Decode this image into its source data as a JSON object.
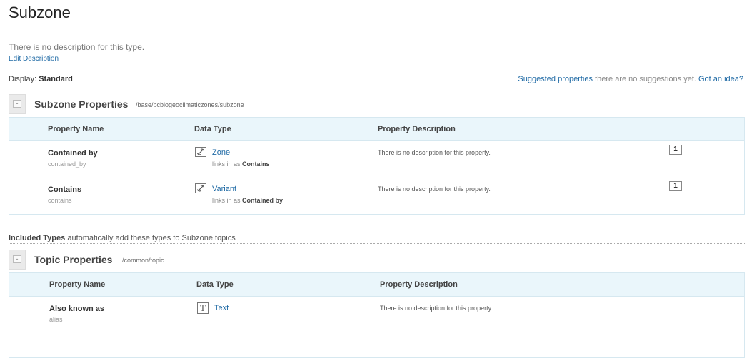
{
  "page": {
    "title": "Subzone",
    "description": "There is no description for this type.",
    "edit_label": "Edit Description",
    "display_label": "Display:",
    "display_value": "Standard",
    "suggest_link": "Suggested properties",
    "suggest_text": "there are no suggestions yet.",
    "suggest_idea": "Got an idea?"
  },
  "sections": [
    {
      "title": "Subzone Properties",
      "path": "/base/bcbiogeoclimaticzones/subzone",
      "headers": [
        "Property Name",
        "Data Type",
        "Property Description"
      ],
      "rows": [
        {
          "name": "Contained by",
          "key": "contained_by",
          "type_icon": "link-icon",
          "type": "Zone",
          "links_prefix": "links in as",
          "links_as": "Contains",
          "description": "There is no description for this property.",
          "count": "1"
        },
        {
          "name": "Contains",
          "key": "contains",
          "type_icon": "link-icon",
          "type": "Variant",
          "links_prefix": "links in as",
          "links_as": "Contained by",
          "description": "There is no description for this property.",
          "count": "1"
        }
      ]
    },
    {
      "title": "Topic Properties",
      "path": "/common/topic",
      "headers": [
        "Property Name",
        "Data Type",
        "Property Description"
      ],
      "rows": [
        {
          "name": "Also known as",
          "key": "alias",
          "type_icon": "text-icon",
          "type": "Text",
          "description": "There is no description for this property."
        }
      ]
    }
  ],
  "included": {
    "label": "Included Types",
    "text": "automatically add these types to Subzone topics"
  },
  "colors": {
    "link": "#1f6aa5",
    "rule": "#4aa6cf",
    "table_header_bg": "#eaf6fb"
  }
}
